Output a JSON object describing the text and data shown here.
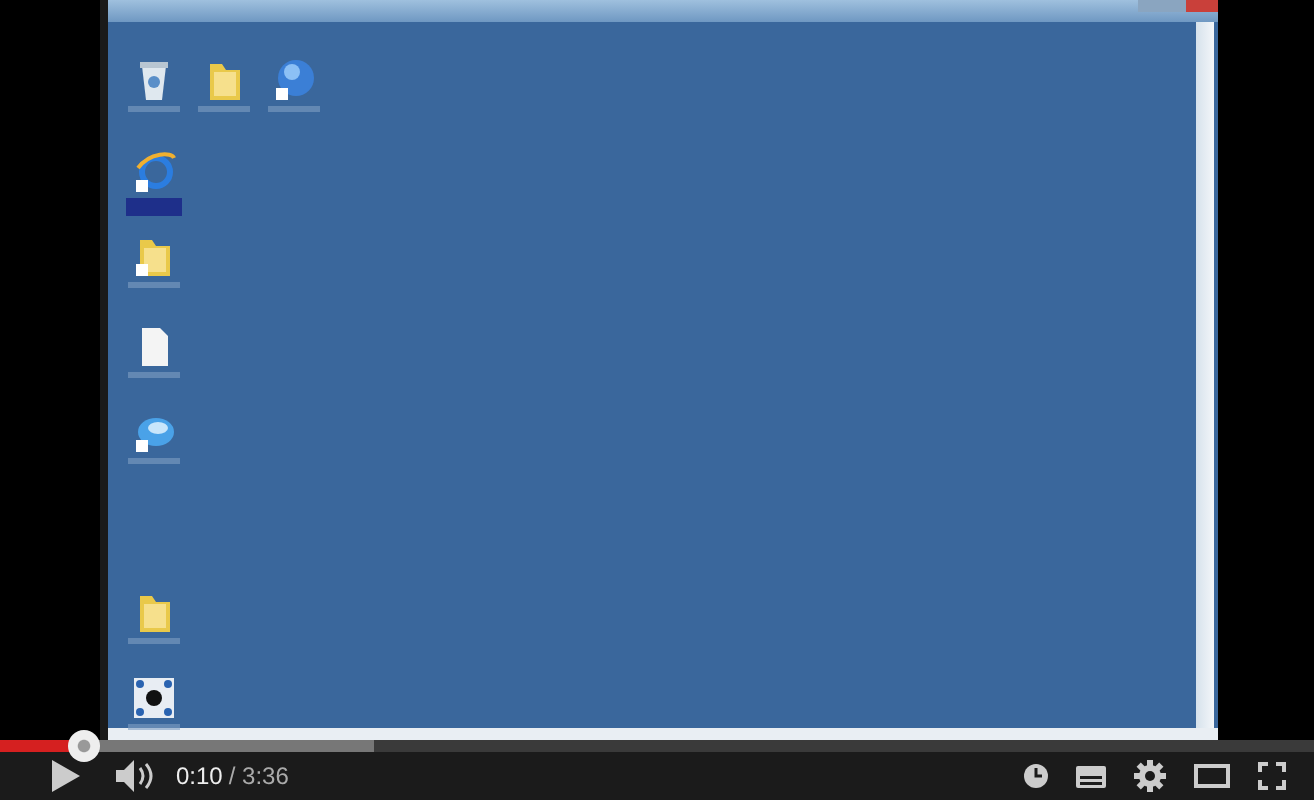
{
  "video": {
    "desktop_icons": [
      {
        "kind": "recycle-bin",
        "selected": false
      },
      {
        "kind": "folder",
        "selected": false
      },
      {
        "kind": "r-app",
        "selected": false
      },
      {
        "kind": "browser",
        "selected": true
      },
      {
        "kind": "folder-shortcut",
        "selected": false
      },
      {
        "kind": "document",
        "selected": false
      },
      {
        "kind": "office",
        "selected": false
      },
      {
        "kind": "folder",
        "selected": false
      },
      {
        "kind": "network-app",
        "selected": false
      }
    ]
  },
  "player": {
    "progress": {
      "level": 0.064
    },
    "buffered": {
      "level": 0.285
    },
    "current_time": "0:10",
    "duration": "/ 3:36"
  }
}
